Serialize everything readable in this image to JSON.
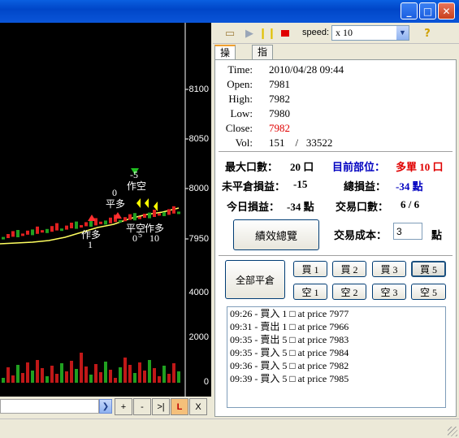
{
  "window": {
    "min_icon": "minimize-icon",
    "max_icon": "maximize-icon",
    "close_icon": "close-icon"
  },
  "chart": {
    "price_ticks": [
      "8100",
      "8050",
      "8000",
      "7950"
    ],
    "volume_ticks": [
      "4000",
      "2000",
      "0"
    ],
    "annotations": {
      "a1": "作多",
      "a1n": "1",
      "a2": "0",
      "a2b": "平多",
      "a3": "-5",
      "a3b": "作空",
      "a4": "平空",
      "a4n": "0",
      "a5": "作多",
      "a5n": "10",
      "a6": "5"
    }
  },
  "chart_controls": {
    "plus": "+",
    "minus": "-",
    "last": ">|",
    "L": "L",
    "X": "X"
  },
  "toolbar": {
    "open_icon": "folder-open-icon",
    "play_icon": "play-icon",
    "pause_icon": "pause-icon",
    "stop_icon": "stop-icon",
    "help_icon": "help-icon",
    "speed_label": "speed:",
    "speed_value": "x 10"
  },
  "tabs": [
    "操作",
    "指標"
  ],
  "ohlc": [
    {
      "k": "Time:",
      "v": "2010/04/28 09:44"
    },
    {
      "k": "Open:",
      "v": "7981"
    },
    {
      "k": "High:",
      "v": "7982"
    },
    {
      "k": "Low:",
      "v": "7980"
    },
    {
      "k": "Close:",
      "v": "7982"
    },
    {
      "k": "Vol:",
      "v": "151    /   33522"
    }
  ],
  "position": {
    "max_lots_label": "最大口數：",
    "max_lots_value": "20 口",
    "current_label": "目前部位：",
    "current_value": "多單 10 口",
    "unrealized_label": "未平倉損益：",
    "unrealized_value": "-15",
    "total_label": "總損益：",
    "total_value": "-34 點",
    "today_label": "今日損益：",
    "today_value": "-34 點",
    "trades_label": "交易口數：",
    "trades_value": "6 / 6"
  },
  "performance_button": "績效總覽",
  "cost": {
    "label": "交易成本：",
    "value": "3",
    "unit": "點"
  },
  "close_all_button": "全部平倉",
  "buy_buttons": [
    "買 1",
    "買 2",
    "買 3",
    "買 5"
  ],
  "sell_buttons": [
    "空 1",
    "空 2",
    "空 3",
    "空 5"
  ],
  "log": [
    "09:26 - 買入 1 □ at price 7977",
    "09:31 - 賣出 1 □ at price 7966",
    "09:35 - 賣出 5 □ at price 7983",
    "09:35 - 買入 5 □ at price 7984",
    "09:36 - 買入 5 □ at price 7982",
    "09:39 - 買入 5 □ at price 7985"
  ]
}
